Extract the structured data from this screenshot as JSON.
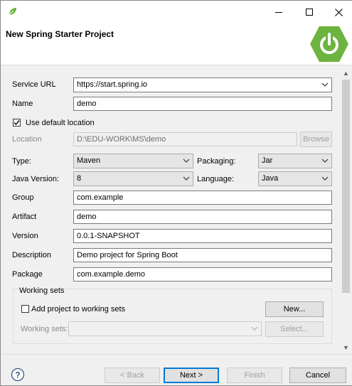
{
  "window": {
    "title": "",
    "header_title": "New Spring Starter Project",
    "accent_color": "#0078d7",
    "spring_green": "#6db33f"
  },
  "form": {
    "service_url_label": "Service URL",
    "service_url_value": "https://start.spring.io",
    "name_label": "Name",
    "name_value": "demo",
    "use_default_location_label": "Use default location",
    "use_default_location_checked": true,
    "location_label": "Location",
    "location_value": "D:\\EDU-WORK\\MS\\demo",
    "browse_label": "Browse",
    "type_label": "Type:",
    "type_value": "Maven",
    "packaging_label": "Packaging:",
    "packaging_value": "Jar",
    "java_version_label": "Java Version:",
    "java_version_value": "8",
    "language_label": "Language:",
    "language_value": "Java",
    "group_label": "Group",
    "group_value": "com.example",
    "artifact_label": "Artifact",
    "artifact_value": "demo",
    "version_label": "Version",
    "version_value": "0.0.1-SNAPSHOT",
    "description_label": "Description",
    "description_value": "Demo project for Spring Boot",
    "package_label": "Package",
    "package_value": "com.example.demo"
  },
  "working_sets": {
    "group_title": "Working sets",
    "add_label": "Add project to working sets",
    "add_checked": false,
    "new_label": "New...",
    "sets_label": "Working sets:",
    "select_label": "Select..."
  },
  "footer": {
    "back_label": "< Back",
    "next_label": "Next >",
    "finish_label": "Finish",
    "cancel_label": "Cancel"
  }
}
